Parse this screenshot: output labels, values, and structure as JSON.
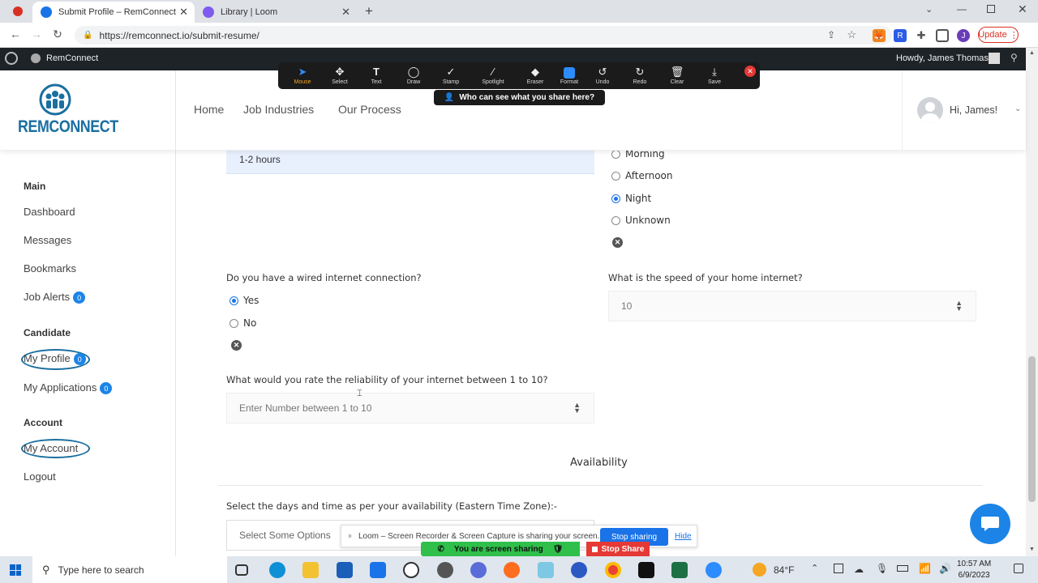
{
  "browser": {
    "tabs": [
      {
        "label": "Submit Profile – RemConnect"
      },
      {
        "label": "Library | Loom"
      }
    ],
    "url": "https://remconnect.io/submit-resume/",
    "update_label": "Update",
    "profile_initial": "J"
  },
  "wpbar": {
    "site_name": "RemConnect",
    "greeting": "Howdy, James Thomas"
  },
  "header": {
    "logo_text": "REMCONNECT",
    "nav": [
      "Home",
      "Job Industries",
      "Our Process"
    ],
    "user_greeting": "Hi, James!"
  },
  "zoom_toolbar": {
    "tools": [
      "Mouse",
      "Select",
      "Text",
      "Draw",
      "Stamp",
      "Spotlight",
      "Eraser",
      "Format",
      "Undo",
      "Redo",
      "Clear",
      "Save"
    ],
    "who_share": "Who can see what you share here?"
  },
  "sidebar": {
    "main_heading": "Main",
    "main_items": [
      "Dashboard",
      "Messages",
      "Bookmarks",
      "Job Alerts"
    ],
    "job_alerts_count": "0",
    "candidate_heading": "Candidate",
    "my_profile": "My Profile",
    "my_profile_count": "0",
    "my_applications": "My Applications",
    "my_applications_count": "0",
    "account_heading": "Account",
    "my_account": "My Account",
    "logout": "Logout"
  },
  "form": {
    "hours_value": "1-2 hours",
    "time_options": [
      "Morning",
      "Afternoon",
      "Night",
      "Unknown"
    ],
    "time_selected": "Night",
    "wired_question": "Do you have a wired internet connection?",
    "wired_options": [
      "Yes",
      "No"
    ],
    "wired_selected": "Yes",
    "speed_question": "What is the speed of your home internet?",
    "speed_value": "10",
    "reliability_question": "What would you rate the reliability of your internet between 1 to 10?",
    "reliability_placeholder": "Enter Number between 1 to 10",
    "availability_heading": "Availability",
    "days_question": "Select the days and time as per your availability (Eastern Time Zone):-",
    "days_placeholder": "Select Some Options"
  },
  "loom": {
    "message": "Loom – Screen Recorder & Screen Capture is sharing your screen.",
    "stop_label": "Stop sharing",
    "hide_label": "Hide"
  },
  "zoom_share": {
    "status": "You are screen sharing",
    "stop": "Stop Share"
  },
  "taskbar": {
    "search_placeholder": "Type here to search",
    "weather": "84°F",
    "time": "10:57 AM",
    "date": "6/9/2023"
  },
  "colors": {
    "accent": "#1c84e6",
    "logo_blue": "#1a6fa0",
    "selected_bg": "#e8f0fe"
  }
}
